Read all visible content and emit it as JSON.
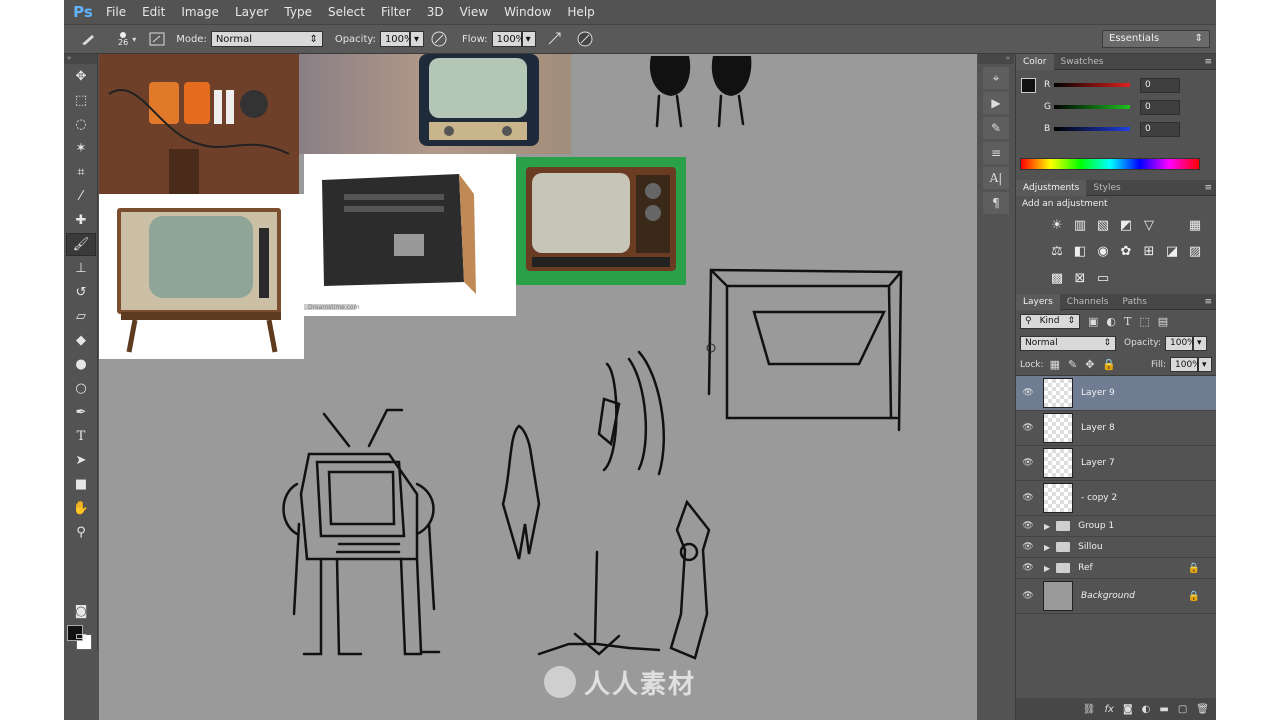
{
  "app": {
    "logo": "Ps"
  },
  "menu": [
    "File",
    "Edit",
    "Image",
    "Layer",
    "Type",
    "Select",
    "Filter",
    "3D",
    "View",
    "Window",
    "Help"
  ],
  "options": {
    "brush_size": "26",
    "mode_label": "Mode:",
    "mode_value": "Normal",
    "opacity_label": "Opacity:",
    "opacity_value": "100%",
    "flow_label": "Flow:",
    "flow_value": "100%",
    "workspace": "Essentials"
  },
  "color_panel": {
    "tabs": [
      "Color",
      "Swatches"
    ],
    "r_label": "R",
    "r_value": "0",
    "g_label": "G",
    "g_value": "0",
    "b_label": "B",
    "b_value": "0",
    "colors": {
      "r": "#e02020",
      "g": "#20c020",
      "b": "#2040e0"
    }
  },
  "adjustments_panel": {
    "tabs": [
      "Adjustments",
      "Styles"
    ],
    "heading": "Add an adjustment"
  },
  "layers_panel": {
    "tabs": [
      "Layers",
      "Channels",
      "Paths"
    ],
    "kind_label": "Kind",
    "blend_mode": "Normal",
    "opacity_label": "Opacity:",
    "opacity_value": "100%",
    "lock_label": "Lock:",
    "fill_label": "Fill:",
    "fill_value": "100%",
    "layers": [
      {
        "name": "Layer 9",
        "type": "layer",
        "selected": true,
        "locked": false
      },
      {
        "name": "Layer 8",
        "type": "layer",
        "selected": false,
        "locked": false
      },
      {
        "name": "Layer 7",
        "type": "layer",
        "selected": false,
        "locked": false
      },
      {
        "name": "- copy 2",
        "type": "layer",
        "selected": false,
        "locked": false
      },
      {
        "name": "Group 1",
        "type": "group",
        "selected": false,
        "locked": false
      },
      {
        "name": "Sillou",
        "type": "group",
        "selected": false,
        "locked": false
      },
      {
        "name": "Ref",
        "type": "group",
        "selected": false,
        "locked": true
      },
      {
        "name": "Background",
        "type": "background",
        "selected": false,
        "locked": true
      }
    ]
  },
  "watermark": {
    "text": "人人素材"
  },
  "ref_images": {
    "small_caption": "Dreamstime.com"
  }
}
